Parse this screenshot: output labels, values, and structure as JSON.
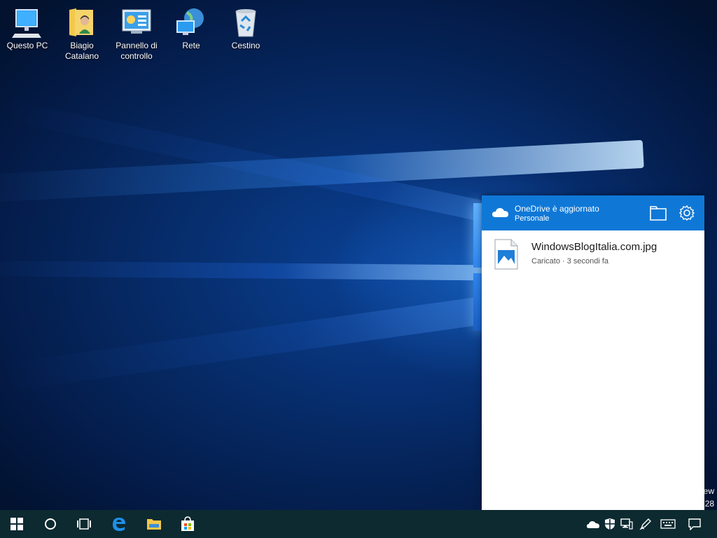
{
  "desktop": {
    "icons": [
      {
        "label": "Questo PC",
        "icon": "computer-icon"
      },
      {
        "label": "Biagio\nCatalano",
        "icon": "user-folder-icon"
      },
      {
        "label": "Pannello di\ncontrollo",
        "icon": "control-panel-icon"
      },
      {
        "label": "Rete",
        "icon": "network-icon"
      },
      {
        "label": "Cestino",
        "icon": "recycle-bin-icon"
      }
    ],
    "edge_text_1": "ew",
    "edge_text_2": "28"
  },
  "onedrive": {
    "title": "OneDrive è aggiornato",
    "account": "Personale",
    "header_color": "#0f78d7",
    "files": [
      {
        "name": "WindowsBlogItalia.com.jpg",
        "status": "Caricato · 3 secondi fa",
        "icon": "image-file-icon"
      }
    ]
  },
  "taskbar": {
    "color": "#0c2a30",
    "pinned": [
      "start-icon",
      "search-circle-icon",
      "task-view-icon",
      "edge-browser-icon",
      "file-explorer-icon",
      "store-icon"
    ],
    "tray": [
      "onedrive-cloud-icon",
      "defender-shield-icon",
      "network-icon",
      "pen-icon",
      "keyboard-icon",
      "action-center-icon"
    ]
  }
}
